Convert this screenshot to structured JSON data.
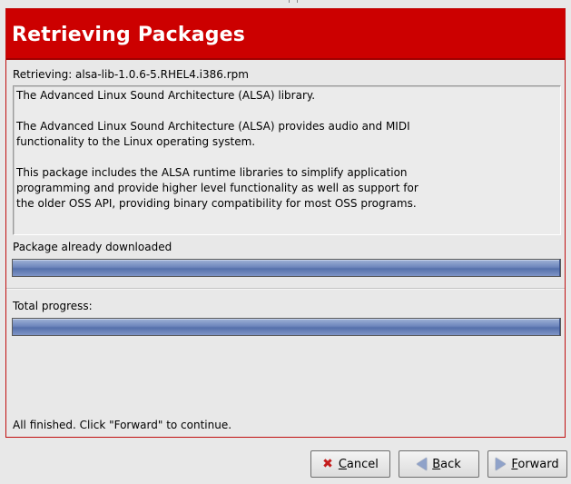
{
  "header": {
    "title": "Retrieving Packages"
  },
  "retrieving_line": "Retrieving:  alsa-lib-1.0.6-5.RHEL4.i386.rpm",
  "description": {
    "paragraphs": [
      "The Advanced Linux Sound Architecture (ALSA) library.",
      "The Advanced Linux Sound Architecture (ALSA) provides audio and MIDI\nfunctionality to the Linux operating system.",
      "This package includes the ALSA runtime libraries to simplify application\nprogramming and provide higher level functionality as well as support for\nthe older OSS API, providing binary compatibility for most OSS programs."
    ]
  },
  "package_progress": {
    "label": "Package already downloaded",
    "fraction": 1.0
  },
  "total_progress": {
    "label": "Total progress:",
    "fraction": 1.0
  },
  "status": "All finished.  Click \"Forward\" to continue.",
  "buttons": {
    "cancel": {
      "mnemonic": "C",
      "rest": "ancel",
      "icon": "cancel-x-icon"
    },
    "back": {
      "mnemonic": "B",
      "rest": "ack",
      "icon": "back-arrow-icon"
    },
    "forward": {
      "mnemonic": "F",
      "rest": "orward",
      "icon": "forward-arrow-icon"
    }
  },
  "colors": {
    "header_bg": "#cc0000",
    "header_text": "#ffffff",
    "progress_fill": "#6f87bd"
  }
}
